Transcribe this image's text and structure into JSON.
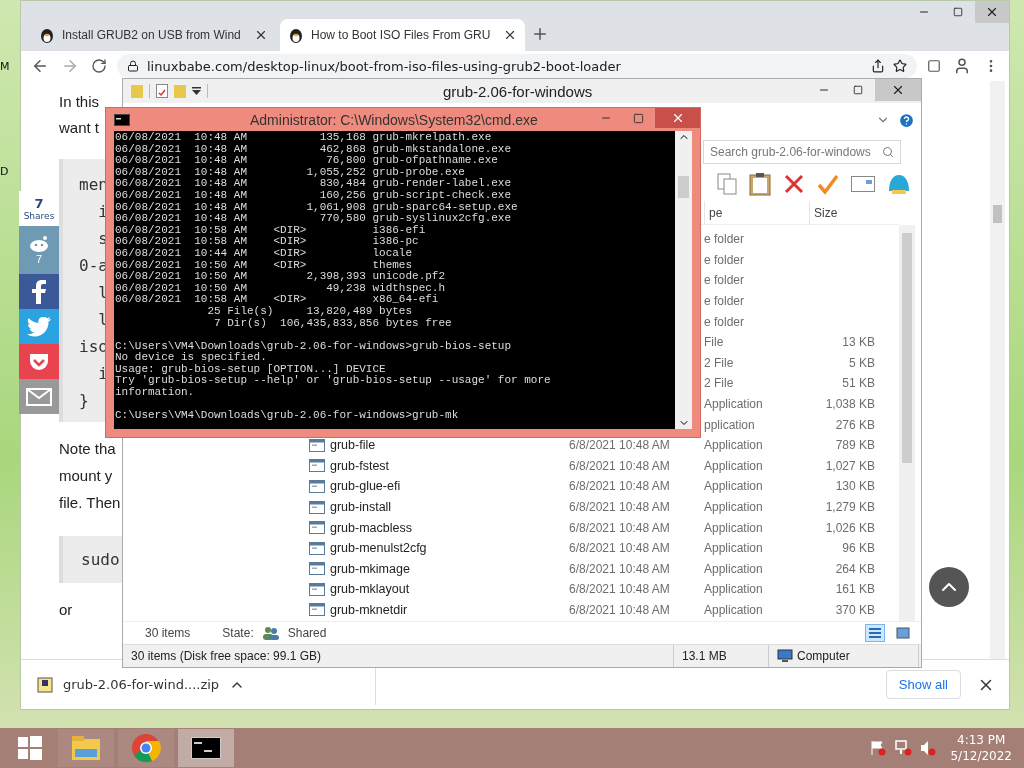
{
  "desktop": {
    "edge_labels": [
      "M",
      "D"
    ]
  },
  "browser": {
    "tabs": [
      {
        "title": "Install GRUB2 on USB from Wind",
        "selected": false
      },
      {
        "title": "How to Boot ISO Files From GRU",
        "selected": true
      }
    ],
    "url": "linuxbabe.com/desktop-linux/boot-from-iso-files-using-grub2-boot-loader",
    "share": {
      "count": "7",
      "label": "Shares",
      "buttons": [
        {
          "kind": "reddit",
          "count": "7"
        },
        {
          "kind": "facebook"
        },
        {
          "kind": "twitter"
        },
        {
          "kind": "pocket"
        },
        {
          "kind": "email"
        }
      ]
    },
    "article": {
      "intro": [
        "In this",
        "want t"
      ],
      "code_lines": [
        "men",
        "  i",
        "  s",
        "0-a",
        "  l",
        "  l",
        "iso",
        "  i",
        "}"
      ],
      "paragraph": [
        "Note tha",
        "mount y",
        "file. Then"
      ],
      "command": "sudo",
      "tail": "or"
    },
    "download": {
      "file": "grub-2.06-for-wind....zip",
      "show_all": "Show all"
    }
  },
  "explorer": {
    "title": "grub-2.06-for-windows",
    "search_placeholder": "Search grub-2.06-for-windows",
    "columns": [
      "pe",
      "Size"
    ],
    "rows": [
      {
        "kind": "partial",
        "type": "e folder"
      },
      {
        "kind": "partial",
        "type": "e folder"
      },
      {
        "kind": "partial",
        "type": "e folder"
      },
      {
        "kind": "partial",
        "type": "e folder"
      },
      {
        "kind": "partial",
        "type": "e folder"
      },
      {
        "kind": "partial",
        "type": "File",
        "size": "13 KB"
      },
      {
        "kind": "partial",
        "type": "2 File",
        "size": "5 KB"
      },
      {
        "kind": "partial",
        "type": "2 File",
        "size": "51 KB"
      },
      {
        "kind": "partial",
        "type": "Application",
        "size": "1,038 KB"
      },
      {
        "kind": "partial",
        "type": "pplication",
        "size": "276 KB"
      },
      {
        "kind": "full",
        "name": "grub-file",
        "date": "6/8/2021 10:48 AM",
        "type": "Application",
        "size": "789 KB"
      },
      {
        "kind": "full",
        "name": "grub-fstest",
        "date": "6/8/2021 10:48 AM",
        "type": "Application",
        "size": "1,027 KB"
      },
      {
        "kind": "full",
        "name": "grub-glue-efi",
        "date": "6/8/2021 10:48 AM",
        "type": "Application",
        "size": "130 KB"
      },
      {
        "kind": "full",
        "name": "grub-install",
        "date": "6/8/2021 10:48 AM",
        "type": "Application",
        "size": "1,279 KB"
      },
      {
        "kind": "full",
        "name": "grub-macbless",
        "date": "6/8/2021 10:48 AM",
        "type": "Application",
        "size": "1,026 KB"
      },
      {
        "kind": "full",
        "name": "grub-menulst2cfg",
        "date": "6/8/2021 10:48 AM",
        "type": "Application",
        "size": "96 KB"
      },
      {
        "kind": "full",
        "name": "grub-mkimage",
        "date": "6/8/2021 10:48 AM",
        "type": "Application",
        "size": "264 KB"
      },
      {
        "kind": "full",
        "name": "grub-mklayout",
        "date": "6/8/2021 10:48 AM",
        "type": "Application",
        "size": "161 KB"
      },
      {
        "kind": "full",
        "name": "grub-mknetdir",
        "date": "6/8/2021 10:48 AM",
        "type": "Application",
        "size": "370 KB"
      }
    ],
    "details": {
      "count": "30 items",
      "state_label": "State:",
      "state": "Shared"
    },
    "views": [
      {
        "kind": "details",
        "selected": true
      },
      {
        "kind": "tiles",
        "selected": false
      }
    ],
    "status": {
      "items": "30 items (Disk free space: 99.1 GB)",
      "size": "13.1 MB",
      "location": "Computer"
    }
  },
  "cmd": {
    "title": "Administrator: C:\\Windows\\System32\\cmd.exe",
    "blocks": [
      [
        "06/08/2021  10:48 AM           135,168 grub-mkrelpath.exe",
        "06/08/2021  10:48 AM           462,868 grub-mkstandalone.exe",
        "06/08/2021  10:48 AM            76,800 grub-ofpathname.exe",
        "06/08/2021  10:48 AM         1,055,252 grub-probe.exe",
        "06/08/2021  10:48 AM           830,484 grub-render-label.exe",
        "06/08/2021  10:48 AM           160,256 grub-script-check.exe",
        "06/08/2021  10:48 AM         1,061,908 grub-sparc64-setup.exe",
        "06/08/2021  10:48 AM           770,580 grub-syslinux2cfg.exe",
        "06/08/2021  10:58 AM    <DIR>          i386-efi",
        "06/08/2021  10:58 AM    <DIR>          i386-pc",
        "06/08/2021  10:44 AM    <DIR>          locale",
        "06/08/2021  10:50 AM    <DIR>          themes",
        "06/08/2021  10:50 AM         2,398,393 unicode.pf2",
        "06/08/2021  10:50 AM            49,238 widthspec.h",
        "06/08/2021  10:58 AM    <DIR>          x86_64-efi",
        "              25 File(s)     13,820,489 bytes",
        "               7 Dir(s)  106,435,833,856 bytes free"
      ],
      [
        "C:\\Users\\VM4\\Downloads\\grub-2.06-for-windows>grub-bios-setup",
        "No device is specified.",
        "Usage: grub-bios-setup [OPTION...] DEVICE",
        "Try 'grub-bios-setup --help' or 'grub-bios-setup --usage' for more",
        "information."
      ],
      [
        "C:\\Users\\VM4\\Downloads\\grub-2.06-for-windows>grub-mk"
      ]
    ]
  },
  "taskbar": {
    "apps": [
      {
        "kind": "explorer",
        "selected": false
      },
      {
        "kind": "chrome",
        "selected": false
      },
      {
        "kind": "cmd",
        "selected": true
      }
    ],
    "time": "4:13 PM",
    "date": "5/12/2022"
  }
}
